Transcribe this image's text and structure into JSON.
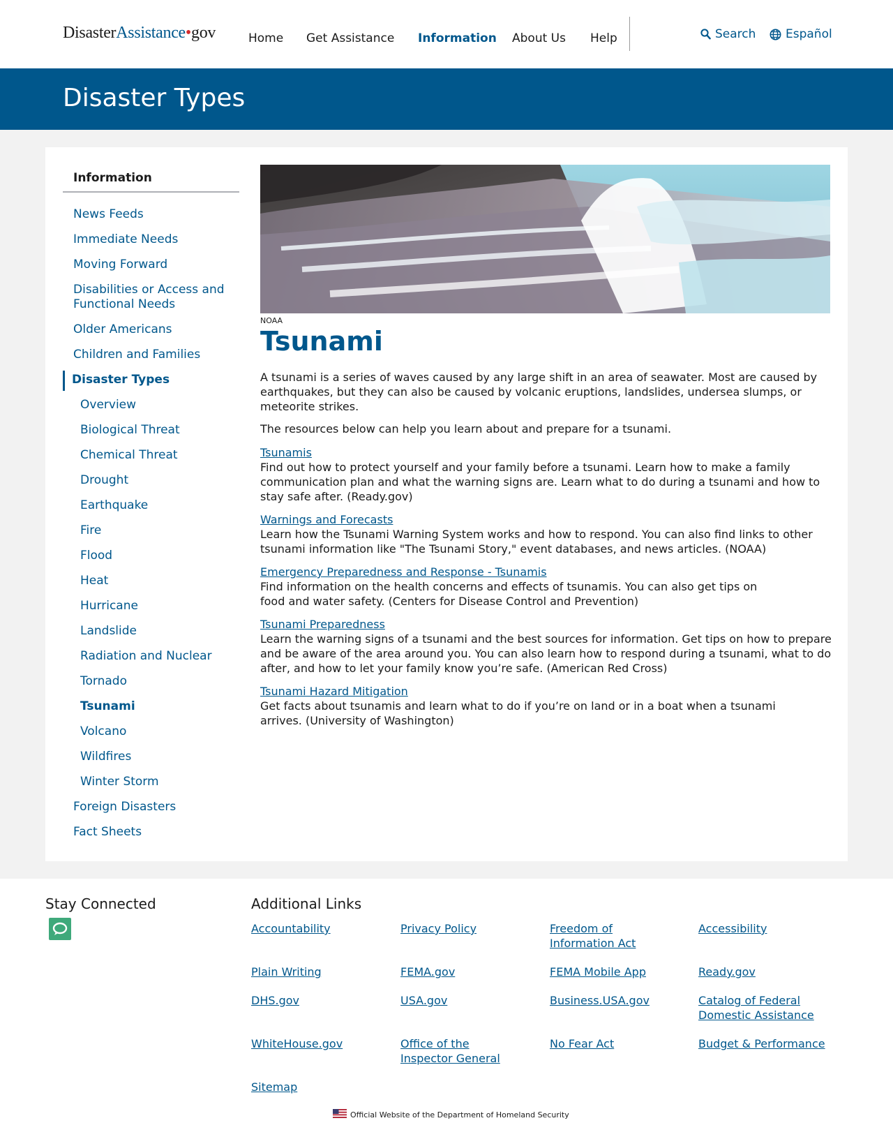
{
  "header": {
    "logo": {
      "part1": "Disaster",
      "part2": "Assistance",
      "dot": "•",
      "part3": "gov"
    },
    "nav": [
      "Home",
      "Get Assistance",
      "Information",
      "About Us",
      "Help"
    ],
    "search_label": "Search",
    "language_label": "Español"
  },
  "banner": {
    "title": "Disaster Types"
  },
  "sidebar": {
    "heading": "Information",
    "items": [
      "News Feeds",
      "Immediate Needs",
      "Moving Forward",
      "Disabilities or Access and Functional Needs",
      "Older Americans",
      "Children and Families",
      "Disaster Types",
      "Overview",
      "Biological Threat",
      "Chemical Threat",
      "Drought",
      "Earthquake",
      "Fire",
      "Flood",
      "Heat",
      "Hurricane",
      "Landslide",
      "Radiation and Nuclear",
      "Tornado",
      "Tsunami",
      "Volcano",
      "Wildfires",
      "Winter Storm",
      "Foreign Disasters",
      "Fact Sheets"
    ]
  },
  "main": {
    "image_credit": "NOAA",
    "title": "Tsunami",
    "intro": "A tsunami is a series of waves caused by any large shift in an area of seawater. Most are caused by earthquakes, but they can also be caused by volcanic eruptions, landslides, undersea slumps, or meteorite strikes.",
    "resources_intro": "The resources below can help you learn about and prepare for a tsunami.",
    "resources": [
      {
        "title": "Tsunamis",
        "desc": "Find out how to protect yourself and your family before a tsunami. Learn how to make a family communication plan and what the warning signs are. Learn what to do during a tsunami and how to stay safe after. (Ready.gov)"
      },
      {
        "title": "Warnings and Forecasts",
        "desc": "Learn how the Tsunami Warning System works and how to respond. You can also find links to other tsunami information like \"The Tsunami Story,\" event databases, and news articles. (NOAA)"
      },
      {
        "title": "Emergency Preparedness and Response - Tsunamis",
        "desc": "Find information on the health concerns and effects of tsunamis. You can also get tips on food and water safety. (Centers for Disease Control and Prevention)"
      },
      {
        "title": "Tsunami Preparedness",
        "desc": "Learn the warning signs of a tsunami and the best sources for information. Get tips on how to prepare and be aware of the area around you. You can also learn how to respond during a tsunami, what to do after, and how to let your family know you’re safe. (American Red Cross)"
      },
      {
        "title": "Tsunami Hazard Mitigation",
        "desc": "Get facts about tsunamis and learn what to do if you’re on land or in a boat when a tsunami arrives. (University of Washington)"
      }
    ]
  },
  "footer": {
    "stay_connected": "Stay Connected",
    "additional_links": "Additional Links",
    "links": [
      "Accountability",
      "Privacy Policy",
      "Freedom of Information Act",
      "Accessibility",
      "Plain Writing",
      "FEMA.gov",
      "FEMA Mobile App",
      "Ready.gov",
      "DHS.gov",
      "USA.gov",
      "Business.USA.gov",
      "Catalog of Federal Domestic Assistance",
      "WhiteHouse.gov",
      "Office of the Inspector General",
      "No Fear Act",
      "Budget & Performance",
      "Sitemap"
    ],
    "official": "Official Website of the Department of Homeland Security"
  },
  "colors": {
    "brand_blue": "#00578c",
    "accent_red": "#d62b2b",
    "chat_green": "#3fa97b"
  },
  "icons": {
    "search": "search-icon",
    "language": "globe-icon",
    "chat": "chat-icon",
    "flag": "us-flag-icon"
  }
}
